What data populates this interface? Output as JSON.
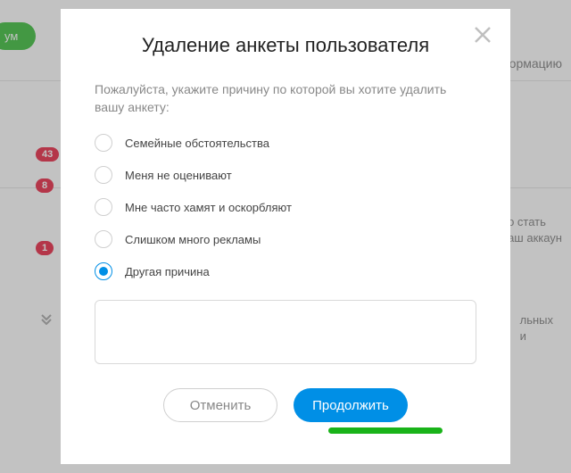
{
  "background": {
    "green_button": "ум",
    "text_info": "ормацию",
    "text_premium1": "о стать",
    "text_premium2": "аш аккаун",
    "text_other1": "льных",
    "text_other2": "и",
    "badges": {
      "b1": "43",
      "b2": "8",
      "b3": "1"
    }
  },
  "modal": {
    "title": "Удаление анкеты пользователя",
    "description": "Пожалуйста, укажите причину по которой вы хотите удалить вашу анкету:",
    "options": [
      {
        "label": "Семейные обстоятельства",
        "selected": false
      },
      {
        "label": "Меня не оценивают",
        "selected": false
      },
      {
        "label": "Мне часто хамят и оскорбляют",
        "selected": false
      },
      {
        "label": "Слишком много рекламы",
        "selected": false
      },
      {
        "label": "Другая причина",
        "selected": true
      }
    ],
    "textarea_value": "",
    "cancel": "Отменить",
    "continue": "Продолжить"
  }
}
